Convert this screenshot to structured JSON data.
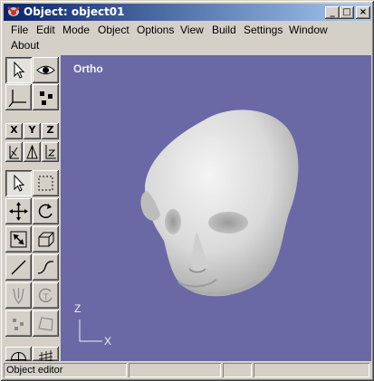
{
  "window": {
    "title": "Object: object01",
    "controls": {
      "minimize": "_",
      "maximize": "□",
      "close": "×"
    }
  },
  "menu": {
    "items": [
      "File",
      "Edit",
      "Mode",
      "Object",
      "Options",
      "View",
      "Build",
      "Settings",
      "Window",
      "About"
    ]
  },
  "toolbar": {
    "axis_buttons": [
      "X",
      "Y",
      "Z"
    ],
    "tools": [
      "select-arrow-icon",
      "eye-icon",
      "axes-icon",
      "points-icon",
      "axis-x-icon",
      "axis-y-icon",
      "axis-z-icon",
      "pivot-x-icon",
      "pivot-y-icon",
      "pivot-z-icon",
      "pointer-icon",
      "marquee-icon",
      "move-icon",
      "rotate-icon",
      "scale-icon",
      "scale-3d-icon",
      "line-icon",
      "curve-icon",
      "magnet-icon",
      "twist-icon",
      "scatter-icon",
      "plane-icon"
    ]
  },
  "viewport": {
    "view_name": "Ortho",
    "axis_z": "Z",
    "axis_x": "X",
    "background": "#6a69a6"
  },
  "status": {
    "text": "Object editor"
  }
}
